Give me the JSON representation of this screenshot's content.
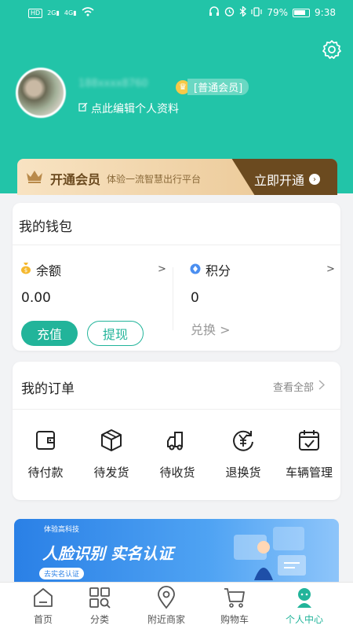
{
  "status_bar": {
    "battery": "79%",
    "time": "9:38",
    "network_1": "2G",
    "network_2": "4G",
    "hd": "HD"
  },
  "profile": {
    "user_id": "188xxxx8760",
    "vip_label": "[普通会员]",
    "edit_label": "点此编辑个人资料"
  },
  "member": {
    "title": "开通会员",
    "subtitle": "体验一流智慧出行平台",
    "cta": "立即开通"
  },
  "wallet": {
    "title": "我的钱包",
    "balance_label": "余额",
    "balance_value": "0.00",
    "balance_arrow": ">",
    "points_label": "积分",
    "points_value": "0",
    "points_arrow": ">",
    "recharge": "充值",
    "withdraw": "提现",
    "redeem": "兑换 >"
  },
  "orders": {
    "title": "我的订单",
    "view_all": "查看全部",
    "items": [
      {
        "label": "待付款",
        "icon": "wallet-icon"
      },
      {
        "label": "待发货",
        "icon": "package-icon"
      },
      {
        "label": "待收货",
        "icon": "truck-icon"
      },
      {
        "label": "退换货",
        "icon": "yen-return-icon"
      },
      {
        "label": "车辆管理",
        "icon": "calendar-check-icon"
      }
    ]
  },
  "banner": {
    "brand": "体验高科技",
    "title": "人脸识别 实名认证",
    "chip": "去实名认证"
  },
  "tabbar": [
    {
      "label": "首页",
      "icon": "home-icon"
    },
    {
      "label": "分类",
      "icon": "grid-search-icon"
    },
    {
      "label": "附近商家",
      "icon": "location-pin-icon"
    },
    {
      "label": "购物车",
      "icon": "cart-icon"
    },
    {
      "label": "个人中心",
      "icon": "person-icon",
      "active": true
    }
  ],
  "colors": {
    "accent": "#22c4a8",
    "accent_dark": "#22b49a",
    "gold": "#6b4a1f",
    "banner_blue": "#2a80e6"
  }
}
